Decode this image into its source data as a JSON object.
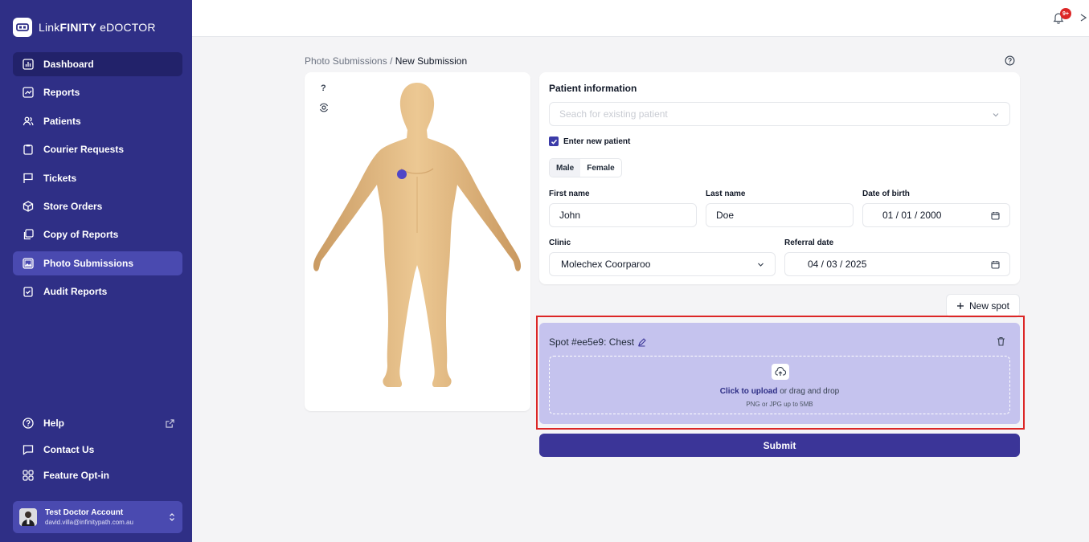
{
  "brand": {
    "prefix": "Link",
    "bold": "FINITY",
    "suffix": " eDOCTOR"
  },
  "sidebar": {
    "items": [
      {
        "label": "Dashboard",
        "icon": "chart-icon"
      },
      {
        "label": "Reports",
        "icon": "report-icon"
      },
      {
        "label": "Patients",
        "icon": "patients-icon"
      },
      {
        "label": "Courier Requests",
        "icon": "clipboard-icon"
      },
      {
        "label": "Tickets",
        "icon": "flag-icon"
      },
      {
        "label": "Store Orders",
        "icon": "box-icon"
      },
      {
        "label": "Copy of Reports",
        "icon": "copy-icon"
      },
      {
        "label": "Photo Submissions",
        "icon": "photo-icon"
      },
      {
        "label": "Audit Reports",
        "icon": "audit-icon"
      }
    ],
    "bottom": [
      {
        "label": "Help",
        "icon": "help-icon"
      },
      {
        "label": "Contact Us",
        "icon": "chat-icon"
      },
      {
        "label": "Feature Opt-in",
        "icon": "grid-icon"
      }
    ],
    "account": {
      "name": "Test Doctor Account",
      "email": "david.villa@infinitypath.com.au"
    }
  },
  "topbar": {
    "notifications": "9+"
  },
  "breadcrumb": {
    "parent": "Photo Submissions",
    "separator": "/",
    "current": "New Submission"
  },
  "model": {
    "hint": "?"
  },
  "patient": {
    "title": "Patient information",
    "search_placeholder": "Seach for existing patient",
    "new_patient_label": "Enter new patient",
    "gender": [
      "Male",
      "Female"
    ],
    "first_name_label": "First name",
    "first_name": "John",
    "last_name_label": "Last name",
    "last_name": "Doe",
    "dob_label": "Date of birth",
    "dob": "01 / 01 / 2000",
    "clinic_label": "Clinic",
    "clinic": "Molechex Coorparoo",
    "referral_label": "Referral date",
    "referral": "04 / 03 / 2025"
  },
  "new_spot": "New spot",
  "spot": {
    "title": "Spot #ee5e9: Chest",
    "upload_link": "Click to upload",
    "upload_rest": " or drag and drop",
    "upload_hint": "PNG or JPG up to 5MB"
  },
  "submit": "Submit",
  "colors": {
    "sidebar": "#2f2f86",
    "active": "#4a4ab0",
    "spot_bg": "#c5c3ee",
    "submit": "#3b3598",
    "highlight": "#dc2626"
  }
}
